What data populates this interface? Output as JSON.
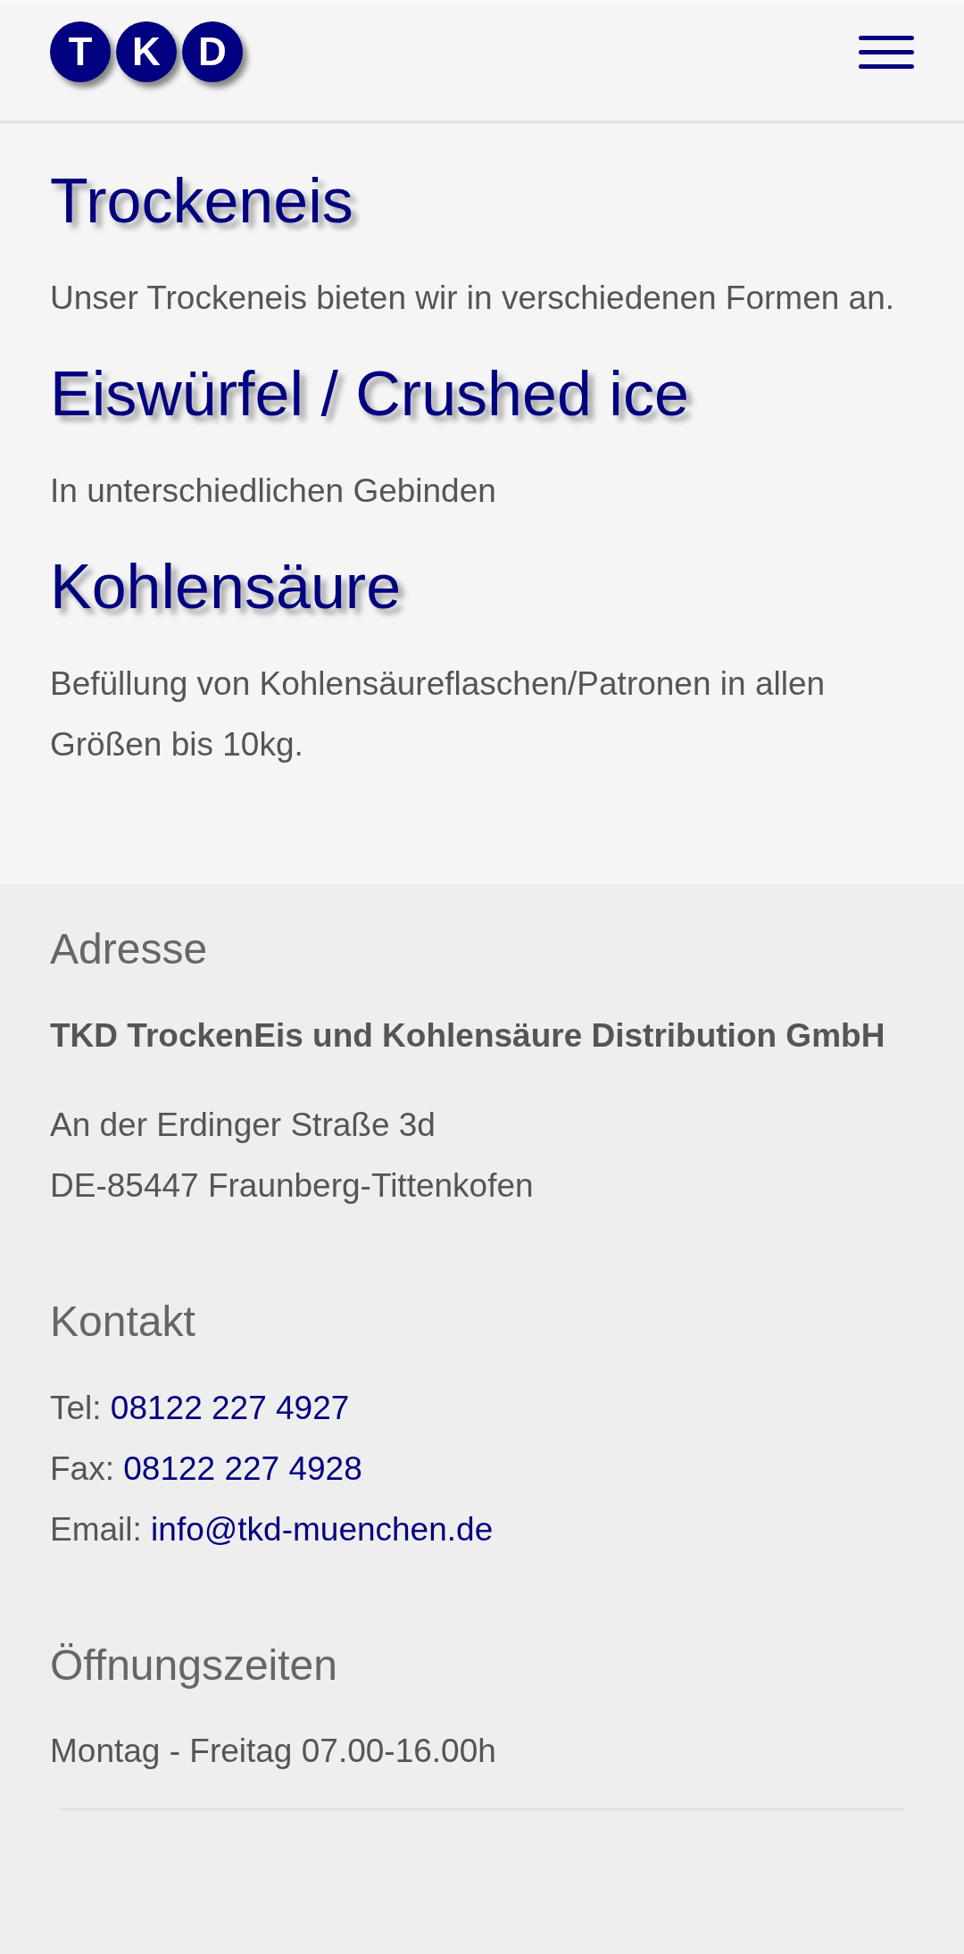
{
  "header": {
    "logo_letters": [
      "T",
      "K",
      "D"
    ]
  },
  "sections": [
    {
      "title": "Trockeneis",
      "text": "Unser Trockeneis bieten wir in verschiedenen Formen an."
    },
    {
      "title": "Eiswürfel / Crushed ice",
      "text": "In unterschiedlichen Gebinden"
    },
    {
      "title": "Kohlensäure",
      "text": "Befüllung von Kohlensäureflaschen/Patronen in allen Größen bis 10kg."
    }
  ],
  "footer": {
    "address": {
      "heading": "Adresse",
      "company": "TKD TrockenEis und Kohlensäure Distribution GmbH",
      "lines": [
        "An der Erdinger Straße 3d",
        "DE-85447 Fraunberg-Tittenkofen"
      ]
    },
    "contact": {
      "heading": "Kontakt",
      "items": [
        {
          "label": "Tel:",
          "value": "08122 227 4927"
        },
        {
          "label": "Fax:",
          "value": "08122 227 4928"
        },
        {
          "label": "Email:",
          "value": "info@tkd-muenchen.de"
        }
      ]
    },
    "hours": {
      "heading": "Öffnungszeiten",
      "text": "Montag - Freitag 07.00-16.00h"
    }
  }
}
